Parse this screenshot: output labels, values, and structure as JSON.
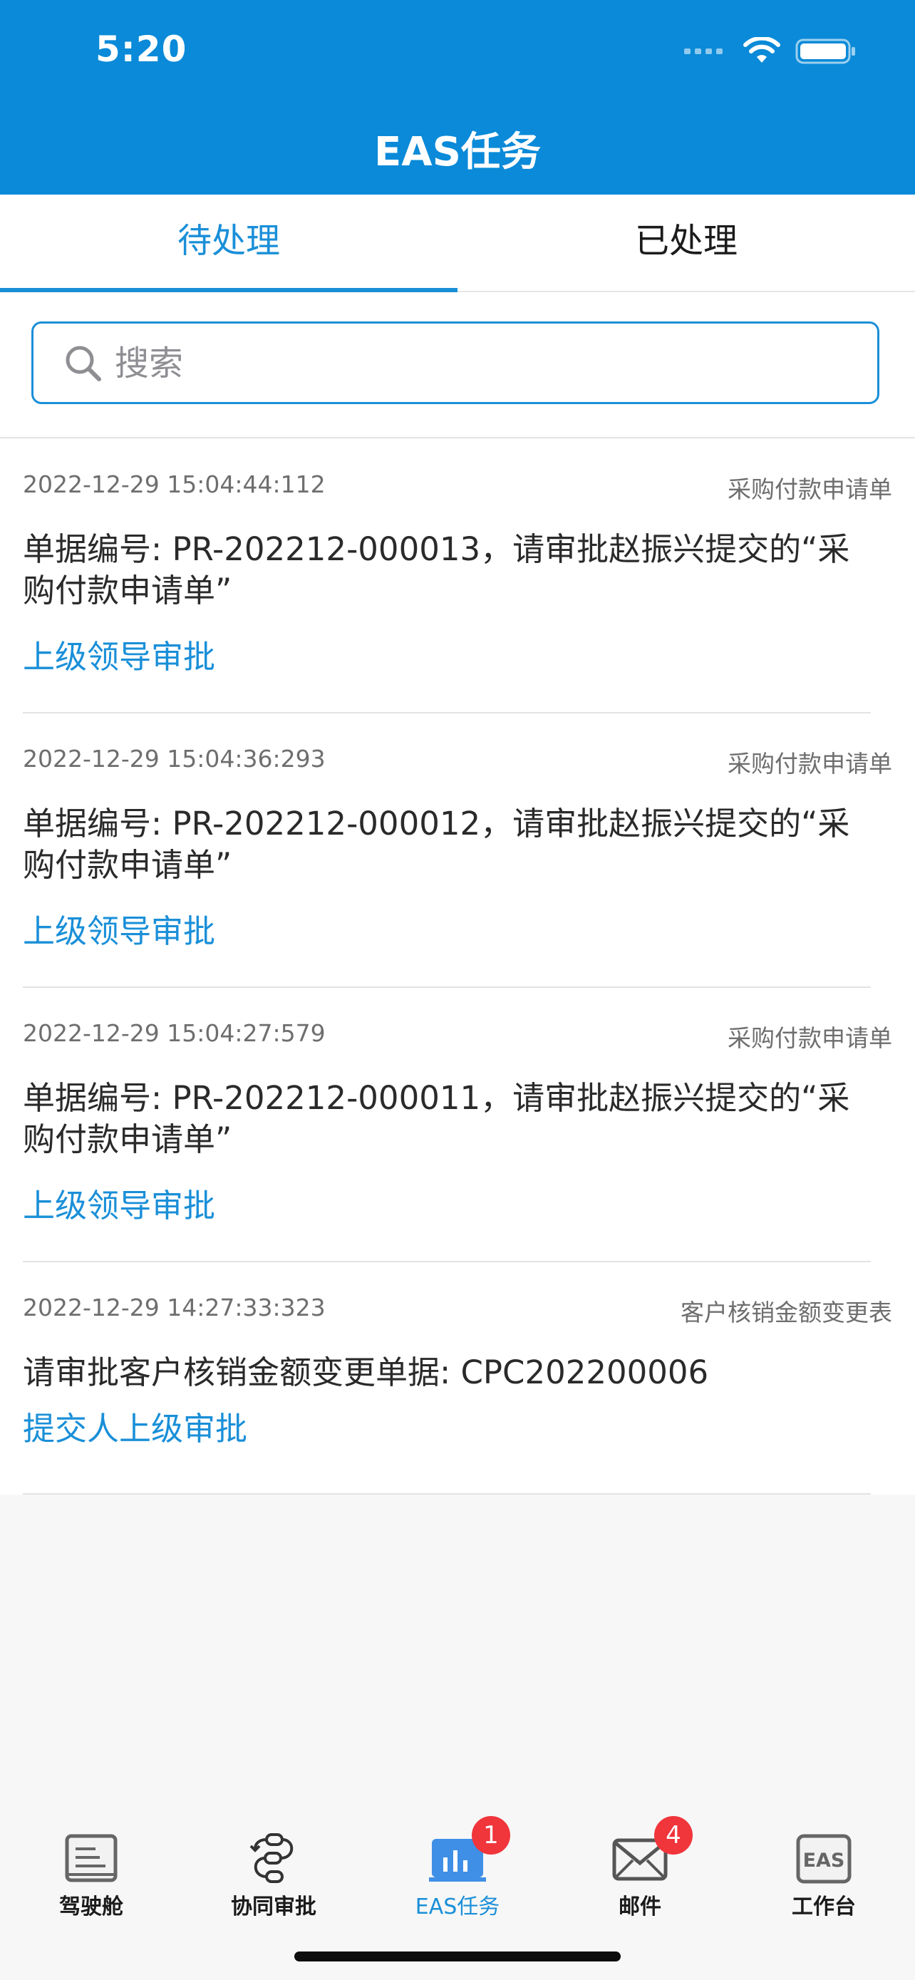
{
  "status_bar": {
    "time": "5:20"
  },
  "header": {
    "title": "EAS任务"
  },
  "tabs": [
    {
      "label": "待处理",
      "active": true
    },
    {
      "label": "已处理",
      "active": false
    }
  ],
  "search": {
    "placeholder": "搜索",
    "value": ""
  },
  "tasks": [
    {
      "time": "2022-12-29 15:04:44:112",
      "type": "采购付款申请单",
      "title": "单据编号: PR-202212-000013，请审批赵振兴提交的“采购付款申请单”",
      "stage": "上级领导审批"
    },
    {
      "time": "2022-12-29 15:04:36:293",
      "type": "采购付款申请单",
      "title": "单据编号: PR-202212-000012，请审批赵振兴提交的“采购付款申请单”",
      "stage": "上级领导审批"
    },
    {
      "time": "2022-12-29 15:04:27:579",
      "type": "采购付款申请单",
      "title": "单据编号: PR-202212-000011，请审批赵振兴提交的“采购付款申请单”",
      "stage": "上级领导审批"
    },
    {
      "time": "2022-12-29 14:27:33:323",
      "type": "客户核销金额变更表",
      "title": "请审批客户核销金额变更单据: CPC202200006",
      "stage": "提交人上级审批"
    }
  ],
  "tabbar": [
    {
      "label": "驾驶舱",
      "icon": "cockpit-icon",
      "badge": ""
    },
    {
      "label": "协同审批",
      "icon": "collaboration-approval-icon",
      "badge": ""
    },
    {
      "label": "EAS任务",
      "icon": "eas-task-chart-icon",
      "badge": "1",
      "active": true
    },
    {
      "label": "邮件",
      "icon": "mail-icon",
      "badge": "4"
    },
    {
      "label": "工作台",
      "icon": "eas-workbench-icon",
      "badge": "",
      "icon_text": "EAS"
    }
  ],
  "colors": {
    "header": "#0a8ad8",
    "accent": "#1a8fd8",
    "badge": "#f0353b"
  }
}
